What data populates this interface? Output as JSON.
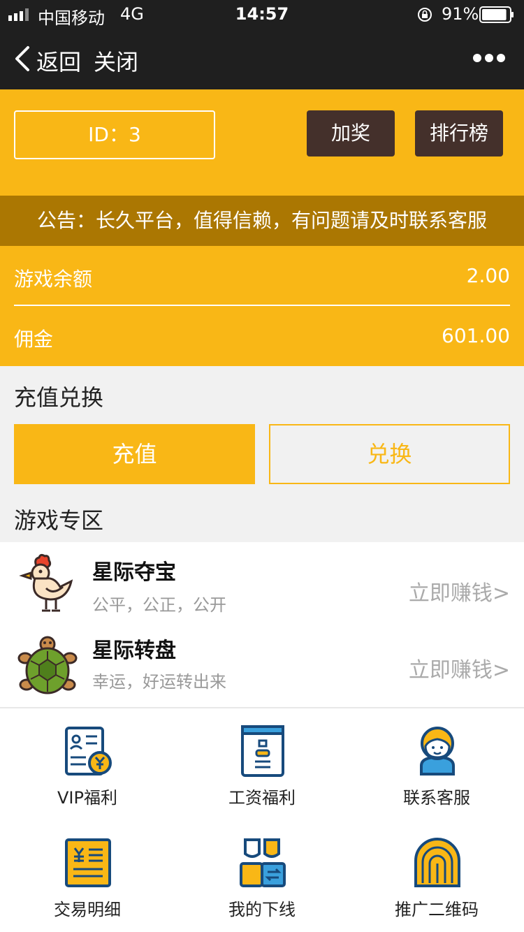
{
  "status_bar": {
    "carrier": "中国移动",
    "network": "4G",
    "time": "14:57",
    "battery": "91%",
    "battery_level": 0.91
  },
  "nav": {
    "back_label": "返回",
    "close_label": "关闭",
    "more_icon": "more-icon"
  },
  "header": {
    "id_text": "ID：3",
    "bonus_label": "加奖",
    "rank_label": "排行榜"
  },
  "notice": "公告：长久平台，值得信赖，有问题请及时联系客服",
  "balances": [
    {
      "label": "游戏余额",
      "value": "2.00"
    },
    {
      "label": "佣金",
      "value": "601.00"
    }
  ],
  "recharge_section": {
    "title": "充值兑换",
    "recharge_label": "充值",
    "exchange_label": "兑换"
  },
  "games_section": {
    "title": "游戏专区",
    "items": [
      {
        "name": "星际夺宝",
        "desc": "公平，公正，公开",
        "cta": "立即赚钱>",
        "icon": "chicken-icon"
      },
      {
        "name": "星际转盘",
        "desc": "幸运，好运转出来",
        "cta": "立即赚钱>",
        "icon": "turtle-icon"
      }
    ]
  },
  "menu": [
    {
      "label": "VIP福利",
      "icon": "vip-card-icon"
    },
    {
      "label": "工资福利",
      "icon": "badge-icon"
    },
    {
      "label": "联系客服",
      "icon": "service-agent-icon"
    },
    {
      "label": "交易明细",
      "icon": "receipt-icon"
    },
    {
      "label": "我的下线",
      "icon": "downline-icon"
    },
    {
      "label": "推广二维码",
      "icon": "fingerprint-icon"
    }
  ],
  "colors": {
    "accent": "#f9b716",
    "notice_bg": "#ab7702",
    "dark_button": "#44302b",
    "topbar": "#1f1f1f"
  }
}
